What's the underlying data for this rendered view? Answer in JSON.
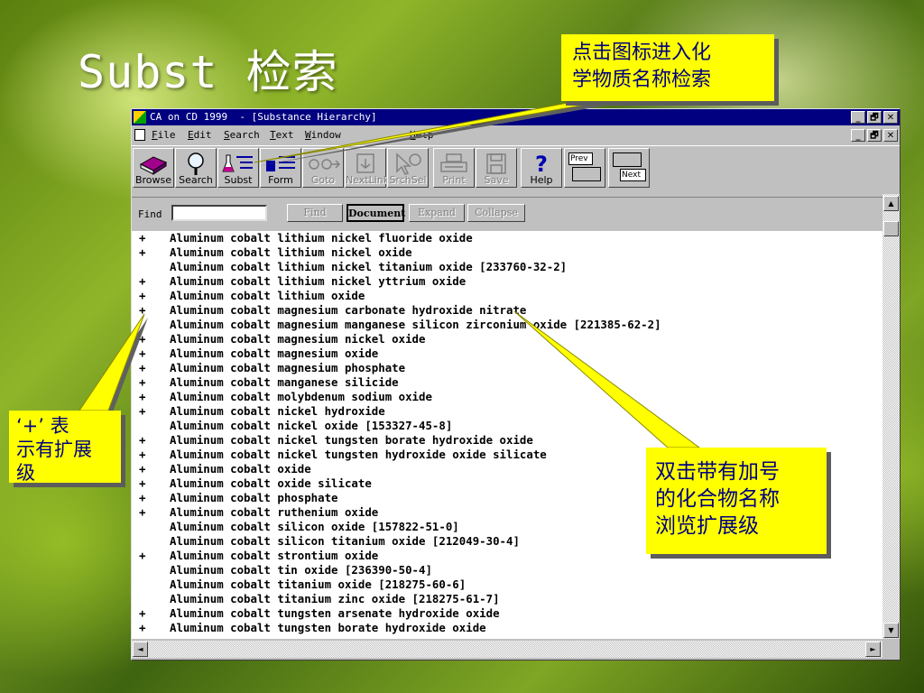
{
  "slide": {
    "title": "Subst 检索",
    "callout_icon": [
      "点击图标进入化",
      "学物质名称检索"
    ],
    "callout_expand": [
      "双击带有加号",
      "的化合物名称",
      "浏览扩展级"
    ],
    "callout_plus": [
      "‘+’ 表",
      "示有扩展",
      "级"
    ]
  },
  "window": {
    "title": "CA on CD 1999  - [Substance Hierarchy]",
    "controls": [
      "_",
      "🗗",
      "✕"
    ],
    "menu": [
      {
        "label": "File",
        "u": "F"
      },
      {
        "label": "Edit",
        "u": "E"
      },
      {
        "label": "Search",
        "u": "S"
      },
      {
        "label": "Text",
        "u": "T"
      },
      {
        "label": "Window",
        "u": "W"
      },
      {
        "label": "Help",
        "u": "H"
      }
    ]
  },
  "toolbar": {
    "buttons": [
      {
        "label": "Browse",
        "icon": "book-icon",
        "enabled": true
      },
      {
        "label": "Search",
        "icon": "magnifier-icon",
        "enabled": true
      },
      {
        "label": "Subst",
        "icon": "flask-icon",
        "enabled": true
      },
      {
        "label": "Form",
        "icon": "form-icon",
        "enabled": true
      },
      {
        "label": "Goto",
        "icon": "goto-icon",
        "enabled": false
      },
      {
        "label": "NextLink",
        "icon": "nextlink-icon",
        "enabled": false
      },
      {
        "label": "SrchSel",
        "icon": "searchsel-icon",
        "enabled": false
      },
      {
        "label": "Print",
        "icon": "printer-icon",
        "enabled": false
      },
      {
        "label": "Save",
        "icon": "disk-icon",
        "enabled": false
      },
      {
        "label": "Help",
        "icon": "question-icon",
        "enabled": true
      }
    ],
    "prev_label": "Prev",
    "next_label": "Next"
  },
  "findbar": {
    "label": "Find",
    "value": "",
    "buttons": [
      {
        "label": "Find",
        "enabled": false
      },
      {
        "label": "Document",
        "enabled": true
      },
      {
        "label": "Expand",
        "enabled": false
      },
      {
        "label": "Collapse",
        "enabled": false
      }
    ]
  },
  "hierarchy": [
    {
      "plus": "+",
      "name": "Aluminum cobalt lithium nickel fluoride oxide"
    },
    {
      "plus": "+",
      "name": "Aluminum cobalt lithium nickel oxide"
    },
    {
      "plus": "",
      "name": "Aluminum cobalt lithium nickel titanium oxide [233760-32-2]"
    },
    {
      "plus": "+",
      "name": "Aluminum cobalt lithium nickel yttrium oxide"
    },
    {
      "plus": "+",
      "name": "Aluminum cobalt lithium oxide"
    },
    {
      "plus": "+",
      "name": "Aluminum cobalt magnesium carbonate hydroxide nitrate"
    },
    {
      "plus": "",
      "name": "Aluminum cobalt magnesium manganese silicon zirconium oxide [221385-62-2]"
    },
    {
      "plus": "+",
      "name": "Aluminum cobalt magnesium nickel oxide"
    },
    {
      "plus": "+",
      "name": "Aluminum cobalt magnesium oxide"
    },
    {
      "plus": "+",
      "name": "Aluminum cobalt magnesium phosphate"
    },
    {
      "plus": "+",
      "name": "Aluminum cobalt manganese silicide"
    },
    {
      "plus": "+",
      "name": "Aluminum cobalt molybdenum sodium oxide"
    },
    {
      "plus": "+",
      "name": "Aluminum cobalt nickel hydroxide"
    },
    {
      "plus": "",
      "name": "Aluminum cobalt nickel oxide [153327-45-8]"
    },
    {
      "plus": "+",
      "name": "Aluminum cobalt nickel tungsten borate hydroxide oxide"
    },
    {
      "plus": "+",
      "name": "Aluminum cobalt nickel tungsten hydroxide oxide silicate"
    },
    {
      "plus": "+",
      "name": "Aluminum cobalt oxide"
    },
    {
      "plus": "+",
      "name": "Aluminum cobalt oxide silicate"
    },
    {
      "plus": "+",
      "name": "Aluminum cobalt phosphate"
    },
    {
      "plus": "+",
      "name": "Aluminum cobalt ruthenium oxide"
    },
    {
      "plus": "",
      "name": "Aluminum cobalt silicon oxide [157822-51-0]"
    },
    {
      "plus": "",
      "name": "Aluminum cobalt silicon titanium oxide [212049-30-4]"
    },
    {
      "plus": "+",
      "name": "Aluminum cobalt strontium oxide"
    },
    {
      "plus": "",
      "name": "Aluminum cobalt tin oxide [236390-50-4]"
    },
    {
      "plus": "",
      "name": "Aluminum cobalt titanium oxide [218275-60-6]"
    },
    {
      "plus": "",
      "name": "Aluminum cobalt titanium zinc oxide [218275-61-7]"
    },
    {
      "plus": "+",
      "name": "Aluminum cobalt tungsten arsenate hydroxide oxide"
    },
    {
      "plus": "+",
      "name": "Aluminum cobalt tungsten borate hydroxide oxide"
    }
  ],
  "scroll": {
    "up": "▲",
    "down": "▼",
    "left": "◄",
    "right": "►"
  },
  "colors": {
    "callout_bg": "#ffff00",
    "callout_text": "#000080",
    "titlebar": "#000080"
  }
}
